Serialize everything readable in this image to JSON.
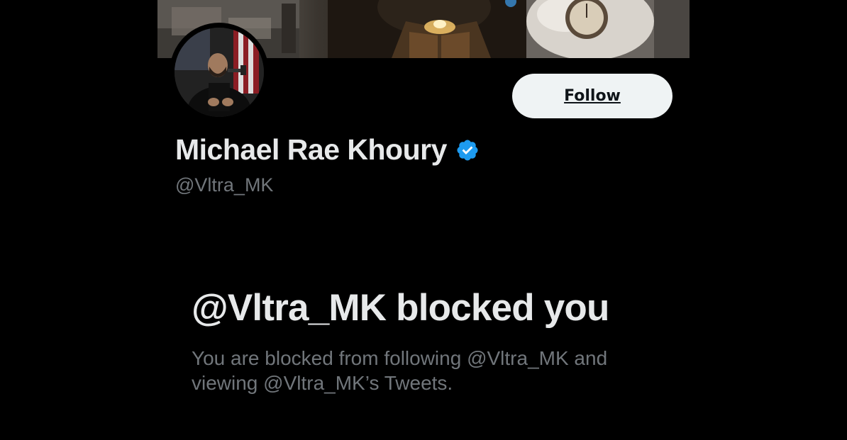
{
  "profile": {
    "display_name": "Michael Rae Khoury",
    "handle": "@Vltra_MK",
    "verified": true,
    "verified_color": "#1d9bf0"
  },
  "actions": {
    "follow_label": "Follow"
  },
  "blocked": {
    "title": "@Vltra_MK blocked you",
    "description": "You are blocked from following @Vltra_MK and viewing @Vltra_MK’s Tweets."
  },
  "icons": {
    "verified": "verified-badge-icon"
  },
  "colors": {
    "background": "#000000",
    "text_primary": "#e7e9ea",
    "text_secondary": "#71767b",
    "follow_button_bg": "#eff3f4"
  }
}
